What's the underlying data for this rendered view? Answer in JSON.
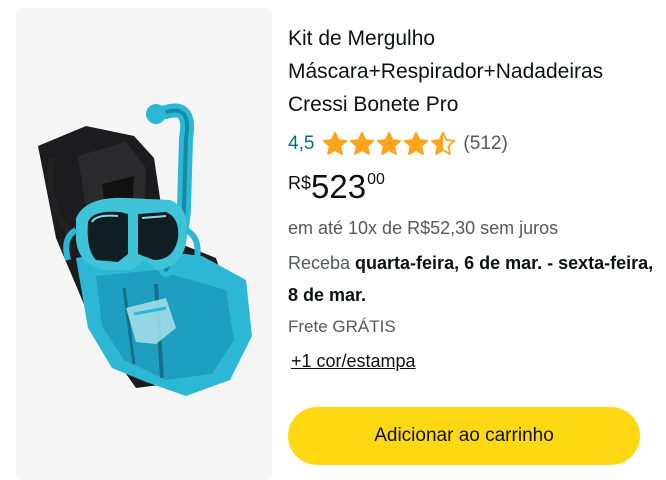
{
  "product": {
    "title_line1": "Kit de Mergulho",
    "title_line2": "Máscara+Respirador+Nadadeiras",
    "title_line3": "Cressi Bonete Pro",
    "rating_value": "4,5",
    "rating": 4.5,
    "rating_max": 5,
    "review_count": "(512)",
    "price_symbol": "R$",
    "price_whole": "523",
    "price_cents": "00",
    "installments": "em até 10x de R$52,30 sem juros",
    "delivery_prefix": "Receba ",
    "delivery_dates": "quarta-feira, 6 de mar. - sexta-feira, 8 de mar.",
    "shipping": "Frete GRÁTIS",
    "variants_link": "+1 cor/estampa",
    "add_to_cart_label": "Adicionar ao carrinho",
    "image_icon": "snorkel-kit-image"
  },
  "colors": {
    "star": "#ffa41c",
    "rating_link": "#007185",
    "button": "#ffd814",
    "image_bg": "#f5f5f6",
    "product_teal": "#2cb8d4"
  }
}
